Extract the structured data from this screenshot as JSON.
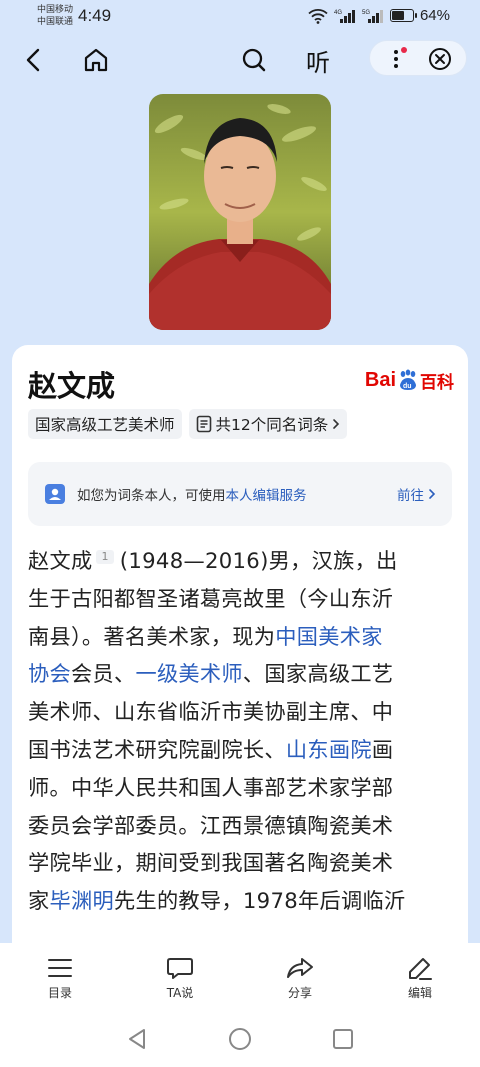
{
  "status": {
    "carrier1": "中国移动",
    "carrier2": "中国联通",
    "time": "4:49",
    "battery": "64%",
    "battery_level": 0.64
  },
  "nav": {
    "listen_label": "听"
  },
  "entry": {
    "title": "赵文成",
    "logo_bai": "Bai",
    "logo_ke": "百科",
    "tag_title": "国家高级工艺美术师",
    "tag_homonyms": "共12个同名词条"
  },
  "banner": {
    "text": "如您为词条本人，可使用",
    "link": "本人编辑服务",
    "go": "前往"
  },
  "article": {
    "l1_a": "赵文成",
    "ref": "1",
    "l1_b": "(1948—2016)男，汉族，出",
    "l2": "生于古阳都智圣诸葛亮故里（今山东沂",
    "l3_a": "南县）。著名美术家，现为",
    "l3_link": "中国美术家",
    "l4_link": "协会",
    "l4_b": "会员、",
    "l4_link2": "一级美术师",
    "l4_c": "、国家高级工艺",
    "l5": "美术师、山东省临沂市美协副主席、中",
    "l6_a": "国书法艺术研究院副院长、",
    "l6_link": "山东画院",
    "l6_b": "画",
    "l7": "师。中华人民共和国人事部艺术家学部",
    "l8": "委员会学部委员。江西景德镇陶瓷美术",
    "l9": "学院毕业，期间受到我国著名陶瓷美术",
    "l10_a": "家",
    "l10_link": "毕渊明",
    "l10_b": "先生的教导，1978年后调临沂"
  },
  "toolbar": {
    "items": [
      {
        "label": "目录"
      },
      {
        "label": "TA说"
      },
      {
        "label": "分享"
      },
      {
        "label": "编辑"
      }
    ]
  }
}
